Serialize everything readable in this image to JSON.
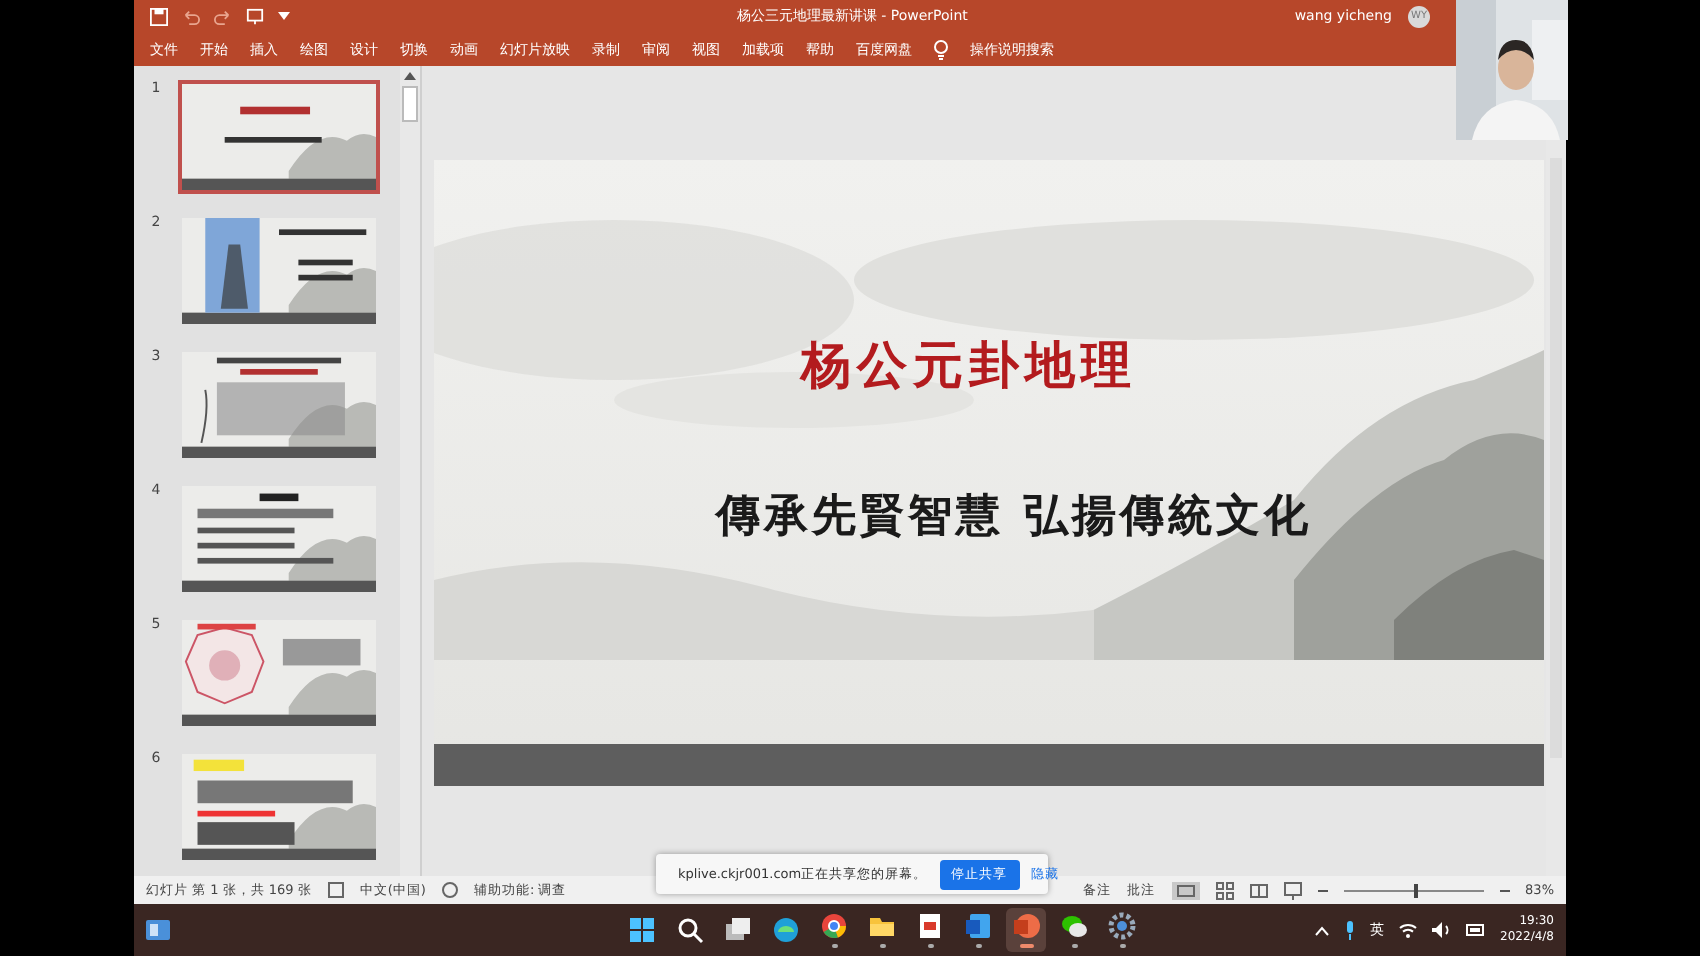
{
  "window": {
    "title": "杨公三元地理最新讲课  -  PowerPoint",
    "user": "wang yicheng",
    "avatar": "WY"
  },
  "ribbon_tabs": [
    "文件",
    "开始",
    "插入",
    "绘图",
    "设计",
    "切换",
    "动画",
    "幻灯片放映",
    "录制",
    "审阅",
    "视图",
    "加载项",
    "帮助",
    "百度网盘"
  ],
  "tell_me": "操作说明搜索",
  "thumbnails": [
    {
      "number": "1",
      "selected": true,
      "kind": "title"
    },
    {
      "number": "2",
      "selected": false,
      "kind": "figure"
    },
    {
      "number": "3",
      "selected": false,
      "kind": "text"
    },
    {
      "number": "4",
      "selected": false,
      "kind": "list"
    },
    {
      "number": "5",
      "selected": false,
      "kind": "diagram"
    },
    {
      "number": "6",
      "selected": false,
      "kind": "table"
    }
  ],
  "slide": {
    "title": "杨公元卦地理",
    "subtitle": "傳承先賢智慧 弘揚傳統文化"
  },
  "share_bar": {
    "message": "kplive.ckjr001.com正在共享您的屏幕。",
    "stop_button": "停止共享",
    "hide_link": "隐藏"
  },
  "status_bar": {
    "slide_info": "幻灯片 第 1 张，共 169 张",
    "language": "中文(中国)",
    "accessibility": "辅助功能: 调查",
    "notes": "备注",
    "comments": "批注",
    "zoom": {
      "level": 0.5,
      "reading": "83%"
    }
  },
  "taskbar": {
    "apps": [
      {
        "kind": "start",
        "running": false,
        "selected": false
      },
      {
        "kind": "search",
        "running": false,
        "selected": false
      },
      {
        "kind": "taskview",
        "running": false,
        "selected": false
      },
      {
        "kind": "edge",
        "running": false,
        "selected": false
      },
      {
        "kind": "chrome",
        "running": true,
        "selected": false
      },
      {
        "kind": "folder",
        "running": true,
        "selected": false
      },
      {
        "kind": "pdf",
        "running": true,
        "selected": false
      },
      {
        "kind": "word",
        "running": true,
        "selected": false
      },
      {
        "kind": "powerpoint",
        "running": true,
        "selected": true
      },
      {
        "kind": "wechat",
        "running": true,
        "selected": false
      },
      {
        "kind": "settings",
        "running": true,
        "selected": false
      }
    ],
    "input_method": "英",
    "time": "19:30",
    "date": "2022/4/8"
  }
}
